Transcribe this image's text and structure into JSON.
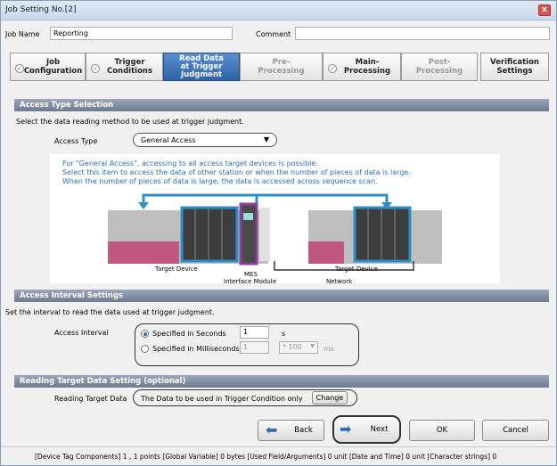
{
  "window": {
    "title": "Job Setting No.[2]",
    "close_label": "x"
  },
  "job": {
    "name_label": "Job Name",
    "name_value": "Reporting",
    "comment_label": "Comment",
    "comment_value": ""
  },
  "steps": [
    {
      "label1": "Job",
      "label2": "Configuration"
    },
    {
      "label1": "Trigger",
      "label2": "Conditions"
    },
    {
      "label1": "Read Data",
      "label2": "at Trigger",
      "label3": "Judgment"
    },
    {
      "label1": "Pre-",
      "label2": "Processing"
    },
    {
      "label1": "Main-",
      "label2": "Processing"
    },
    {
      "label1": "Post-",
      "label2": "Processing"
    },
    {
      "label1": "Verification",
      "label2": "Settings"
    }
  ],
  "access_type": {
    "section_title": "Access Type Selection",
    "description": "Select the data reading method to be used at trigger judgment.",
    "label": "Access Type",
    "value": "General Access",
    "note1": "For \"General Access\", accessing to all access target devices is possible.",
    "note2": "Select this item to access the data of other station or when the number of pieces of data is large.",
    "note3": "When the number of pieces of data is large, the data is accessed across sequence scan.",
    "target_device_left": "Target Device",
    "target_device_right": "Target Device",
    "mes_label1": "MES",
    "mes_label2": "Interface Module",
    "network_label": "Network"
  },
  "interval": {
    "section_title": "Access Interval Settings",
    "description": "Set the interval to read the data used at trigger judgment.",
    "label": "Access Interval",
    "opt_seconds": "Specified in Seconds",
    "seconds_value": "1",
    "seconds_unit": "s",
    "opt_ms": "Specified in Milliseconds",
    "ms_value": "1",
    "ms_multiplier": "* 100",
    "ms_unit": "ms"
  },
  "reading_target": {
    "section_title": "Reading Target Data Setting (optional)",
    "label": "Reading Target Data",
    "value": "The Data to be used in Trigger Condition only",
    "change_label": "Change"
  },
  "buttons": {
    "back": "Back",
    "next": "Next",
    "ok": "OK",
    "cancel": "Cancel"
  },
  "status": "[Device Tag Components]  1 ,  1 points  [Global Variable]  0 bytes  [Used Field/Arguments]  0 unit  [Date and Time]  0 unit  [Character strings]  0"
}
